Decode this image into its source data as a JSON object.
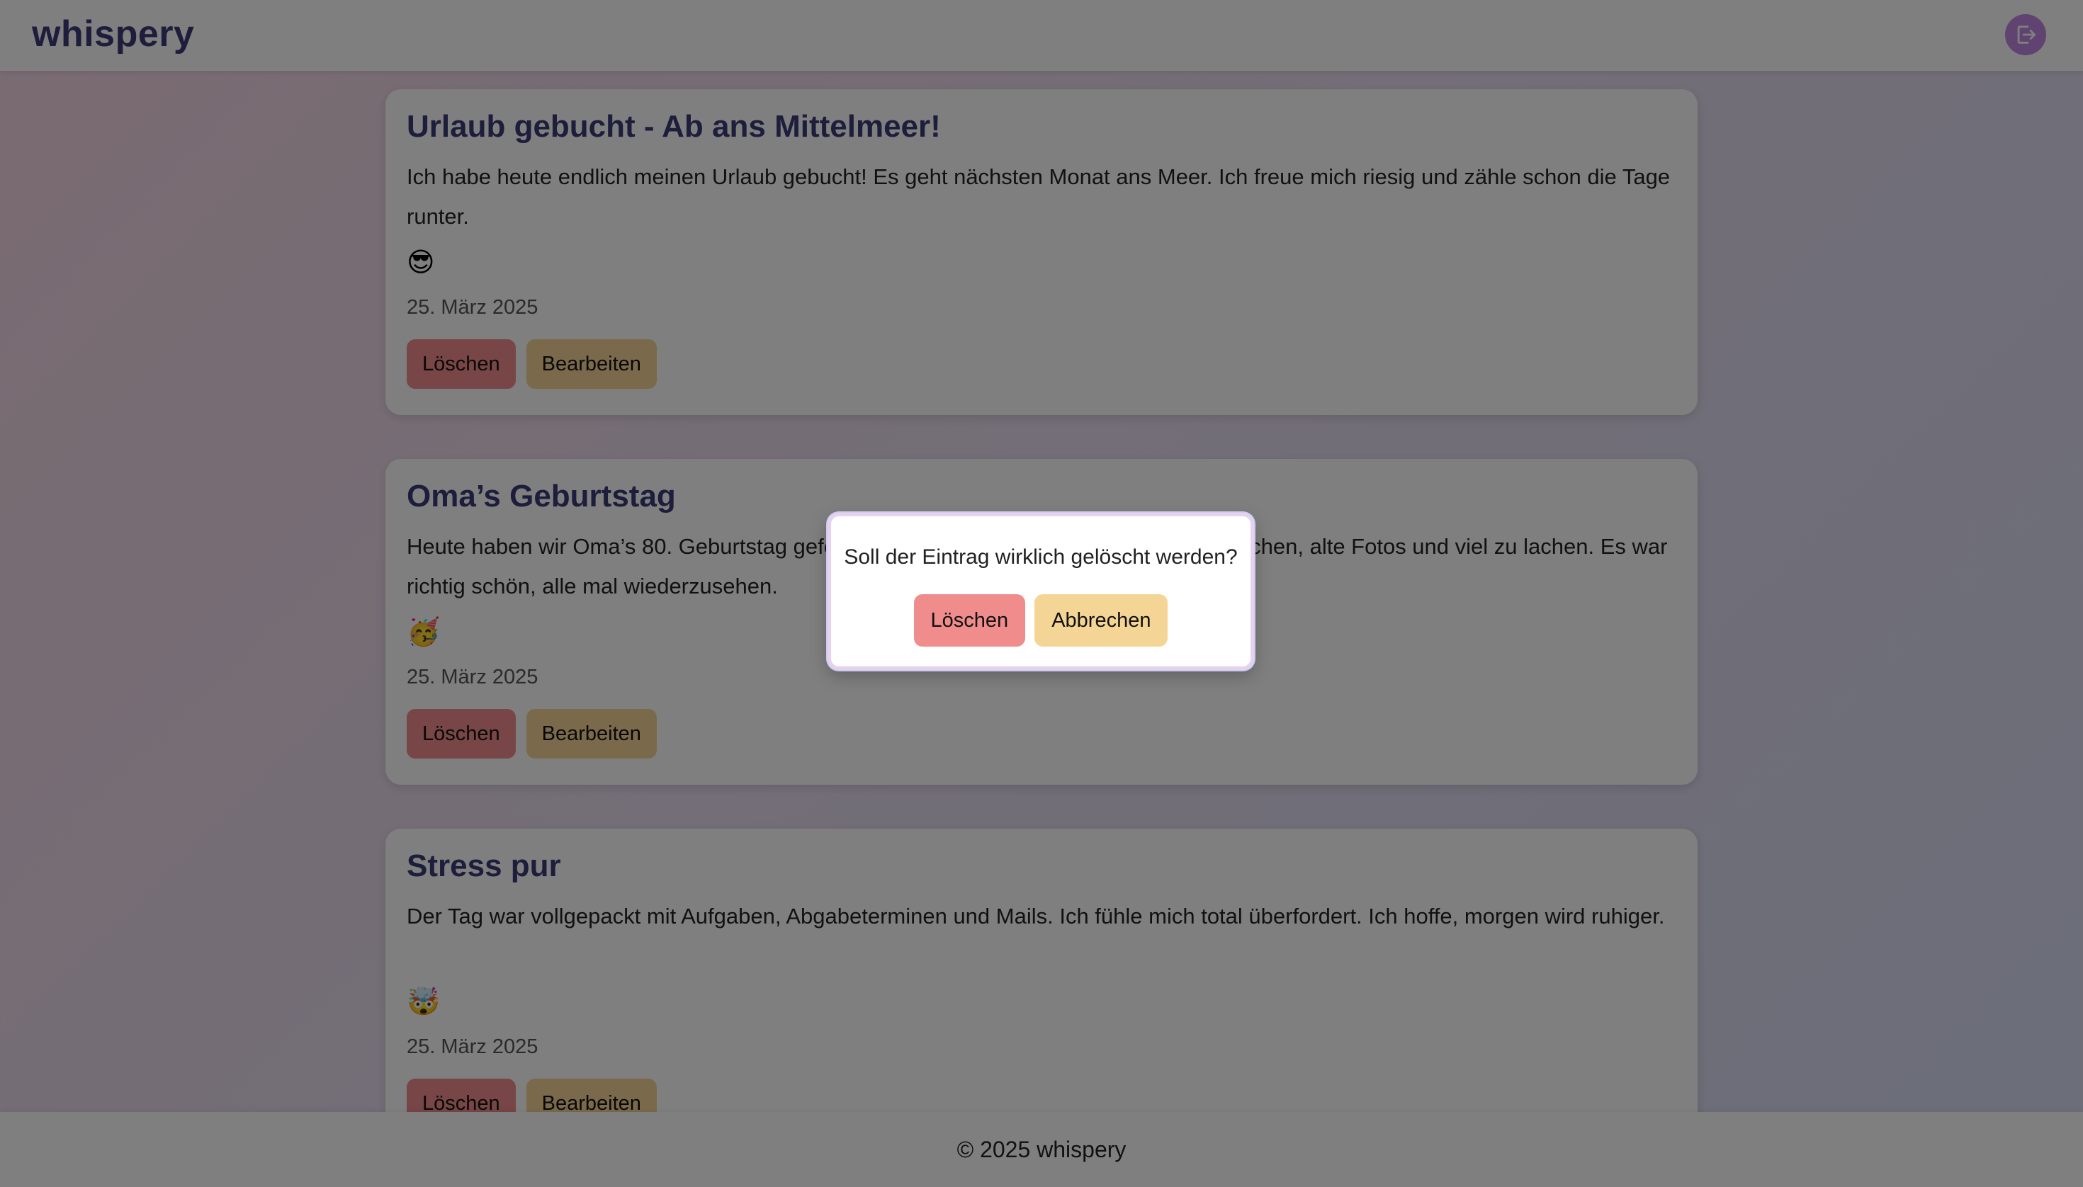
{
  "header": {
    "brand": "whispery",
    "logout_icon": "logout-icon"
  },
  "entries": [
    {
      "title": "Urlaub gebucht - Ab ans Mittelmeer!",
      "text": "Ich habe heute endlich meinen Urlaub gebucht! Es geht nächsten Monat ans Meer. Ich freue mich riesig und zähle schon die Tage runter.",
      "emoji": "😎",
      "date": "25. März 2025",
      "delete_label": "Löschen",
      "edit_label": "Bearbeiten"
    },
    {
      "title": "Oma’s Geburtstag",
      "text": "Heute haben wir Oma’s 80. Geburtstag gefeiert. Die ganze Familie war da – es gab Kuchen, alte Fotos und viel zu lachen. Es war richtig schön, alle mal wiederzusehen.",
      "emoji": "🥳",
      "date": "25. März 2025",
      "delete_label": "Löschen",
      "edit_label": "Bearbeiten"
    },
    {
      "title": "Stress pur",
      "text": "Der Tag war vollgepackt mit Aufgaben, Abgabeterminen und Mails. Ich fühle mich total überfordert. Ich hoffe, morgen wird ruhiger.",
      "emoji": "🤯",
      "date": "25. März 2025",
      "delete_label": "Löschen",
      "edit_label": "Bearbeiten"
    }
  ],
  "dialog": {
    "message": "Soll der Eintrag wirklich gelöscht werden?",
    "confirm_label": "Löschen",
    "cancel_label": "Abbrechen"
  },
  "footer": {
    "text": "© 2025 whispery"
  },
  "colors": {
    "brand": "#3e3a78",
    "delete": "#f08c8c",
    "edit": "#f5d596",
    "logout": "#c186e0"
  }
}
